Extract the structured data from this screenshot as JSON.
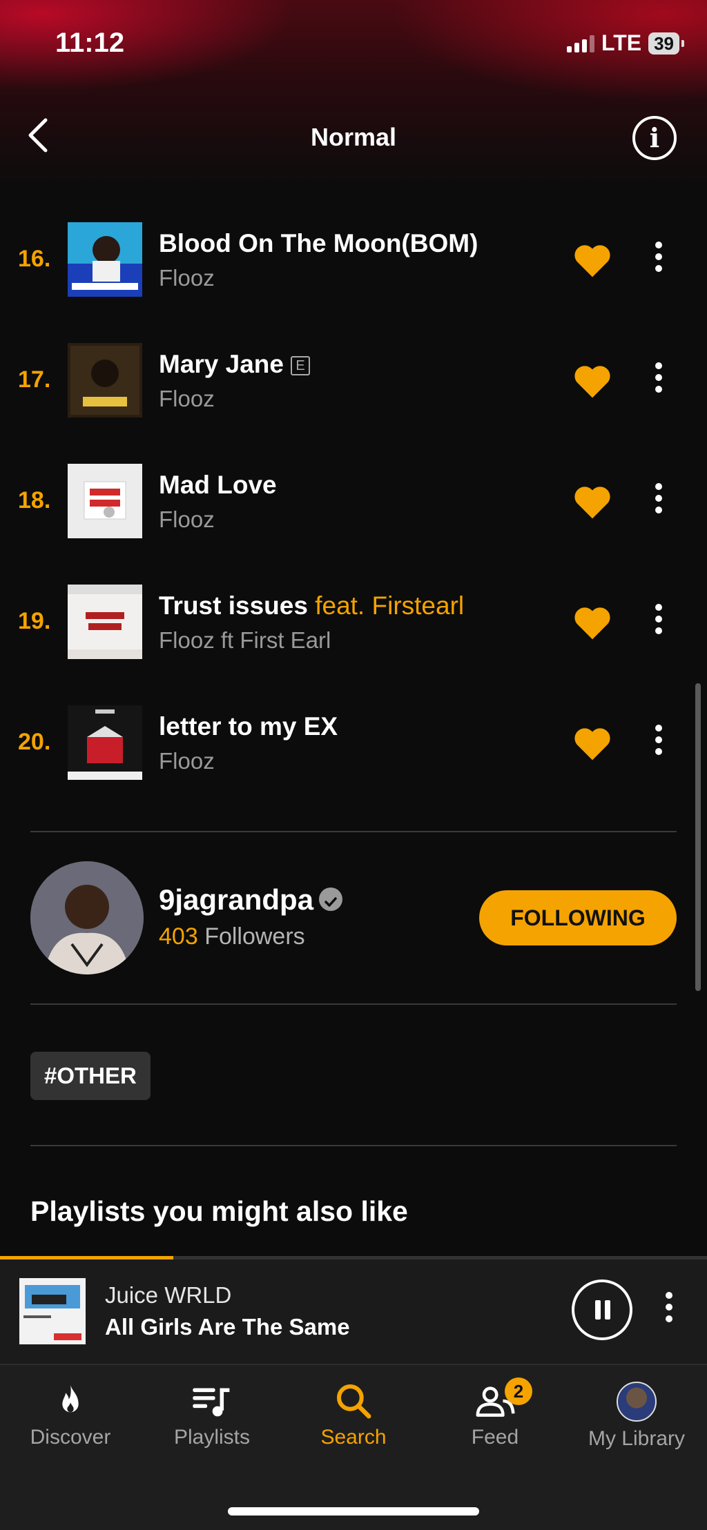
{
  "status_bar": {
    "time": "11:12",
    "network": "LTE",
    "battery": "39"
  },
  "header": {
    "title": "Normal"
  },
  "tracks": [
    {
      "number": "16.",
      "title": "Blood On The Moon(BOM)",
      "feat": "",
      "explicit": "",
      "artist": "Flooz"
    },
    {
      "number": "17.",
      "title": "Mary Jane",
      "feat": "",
      "explicit": "E",
      "artist": "Flooz"
    },
    {
      "number": "18.",
      "title": "Mad Love",
      "feat": "",
      "explicit": "",
      "artist": "Flooz"
    },
    {
      "number": "19.",
      "title": "Trust issues",
      "feat": "feat. Firstearl",
      "explicit": "",
      "artist": "Flooz ft First Earl"
    },
    {
      "number": "20.",
      "title": "letter to my EX",
      "feat": "",
      "explicit": "",
      "artist": "Flooz"
    }
  ],
  "artist": {
    "name": "9jagrandpa",
    "followers_count": "403",
    "followers_label": "Followers",
    "follow_label": "FOLLOWING"
  },
  "tag": "#OTHER",
  "section_title": "Playlists you might also like",
  "now_playing": {
    "artist": "Juice WRLD",
    "title": "All Girls Are The Same",
    "progress": 0.245
  },
  "tabs": [
    {
      "label": "Discover",
      "icon": "flame-icon"
    },
    {
      "label": "Playlists",
      "icon": "playlist-icon"
    },
    {
      "label": "Search",
      "icon": "search-icon",
      "active": true
    },
    {
      "label": "Feed",
      "icon": "people-icon",
      "badge": "2"
    },
    {
      "label": "My Library",
      "icon": "avatar-icon"
    }
  ],
  "colors": {
    "accent": "#f5a300",
    "background": "#0c0c0c"
  }
}
